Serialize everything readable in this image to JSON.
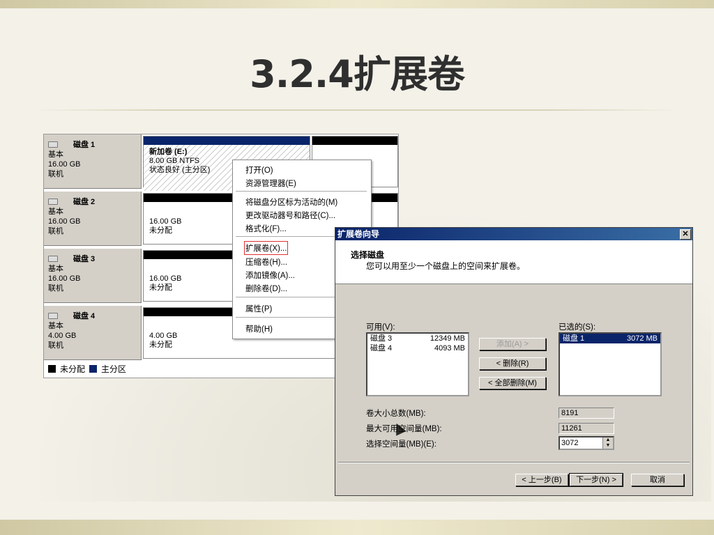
{
  "slide": {
    "title": "3.2.4扩展卷"
  },
  "disk_manager": {
    "disks": [
      {
        "name": "磁盘 1",
        "type": "基本",
        "size": "16.00 GB",
        "status": "联机",
        "partition": {
          "name": "新加卷  (E:)",
          "detail": "8.00 GB NTFS",
          "state": "状态良好 (主分区)"
        }
      },
      {
        "name": "磁盘 2",
        "type": "基本",
        "size": "16.00 GB",
        "status": "联机",
        "partition": {
          "detail": "16.00 GB",
          "state": "未分配"
        }
      },
      {
        "name": "磁盘 3",
        "type": "基本",
        "size": "16.00 GB",
        "status": "联机",
        "partition": {
          "detail": "16.00 GB",
          "state": "未分配"
        }
      },
      {
        "name": "磁盘 4",
        "type": "基本",
        "size": "4.00 GB",
        "status": "联机",
        "partition": {
          "detail": "4.00 GB",
          "state": "未分配"
        }
      }
    ],
    "legend": {
      "unallocated": "未分配",
      "primary": "主分区"
    },
    "colors": {
      "unallocated": "#000000",
      "primary": "#0a246a"
    }
  },
  "context_menu": {
    "items": [
      "打开(O)",
      "资源管理器(E)",
      "将磁盘分区标为活动的(M)",
      "更改驱动器号和路径(C)...",
      "格式化(F)...",
      "扩展卷(X)...",
      "压缩卷(H)...",
      "添加镜像(A)...",
      "删除卷(D)...",
      "属性(P)",
      "帮助(H)"
    ],
    "highlighted": "扩展卷(X)..."
  },
  "wizard": {
    "title": "扩展卷向导",
    "heading": "选择磁盘",
    "subheading": "您可以用至少一个磁盘上的空间来扩展卷。",
    "available_label": "可用(V):",
    "available": [
      {
        "disk": "磁盘 3",
        "size": "12349 MB"
      },
      {
        "disk": "磁盘 4",
        "size": "4093 MB"
      }
    ],
    "selected_label": "已选的(S):",
    "selected": [
      {
        "disk": "磁盘 1",
        "size": "3072 MB"
      }
    ],
    "add_label": "添加(A) >",
    "remove_label": "< 删除(R)",
    "remove_all_label": "< 全部删除(M)",
    "total_label": "卷大小总数(MB):",
    "total_value": "8191",
    "max_label": "最大可用空间量(MB):",
    "max_value": "11261",
    "select_label": "选择空间量(MB)(E):",
    "select_value": "3072",
    "back_label": "< 上一步(B)",
    "next_label": "下一步(N) >",
    "cancel_label": "取消"
  }
}
